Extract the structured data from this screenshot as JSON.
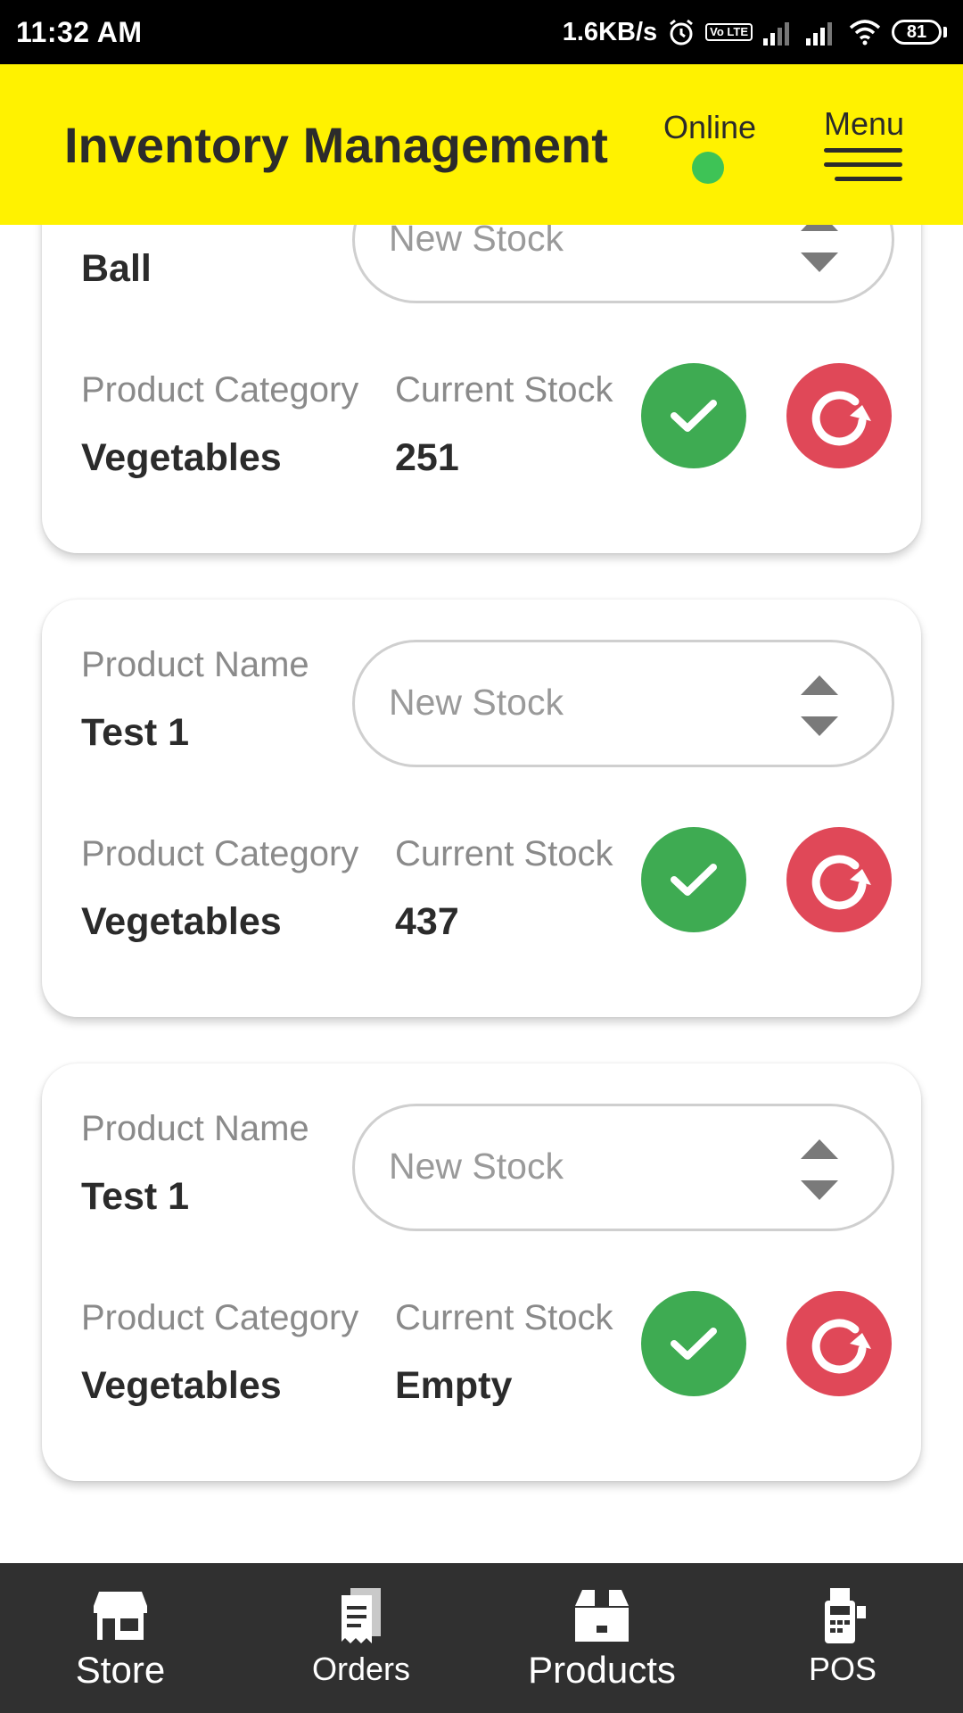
{
  "status_bar": {
    "time": "11:32 AM",
    "speed": "1.6KB/s",
    "volte": "Vo LTE",
    "battery": "81",
    "icons": [
      "alarm-icon",
      "volte-icon",
      "signal-icon",
      "signal-icon",
      "wifi-icon",
      "battery-icon"
    ]
  },
  "header": {
    "title": "Inventory Management",
    "online_label": "Online",
    "online_color": "#3ec356",
    "menu_label": "Menu",
    "background": "#fff200"
  },
  "product_labels": {
    "name": "Product Name",
    "category": "Product Category",
    "stock": "Current Stock",
    "new_stock_placeholder": "New Stock"
  },
  "products": [
    {
      "name": "Ball",
      "category": "Vegetables",
      "stock": "251"
    },
    {
      "name": "Test 1",
      "category": "Vegetables",
      "stock": "437"
    },
    {
      "name": "Test 1",
      "category": "Vegetables",
      "stock": "Empty"
    }
  ],
  "buttons": {
    "confirm_color": "#3eab52",
    "reset_color": "#e04858"
  },
  "bottom_nav": {
    "items": [
      {
        "label": "Store",
        "icon": "store-icon"
      },
      {
        "label": "Orders",
        "icon": "receipt-icon"
      },
      {
        "label": "Products",
        "icon": "box-icon"
      },
      {
        "label": "POS",
        "icon": "pos-terminal-icon"
      }
    ],
    "background": "#303030"
  }
}
